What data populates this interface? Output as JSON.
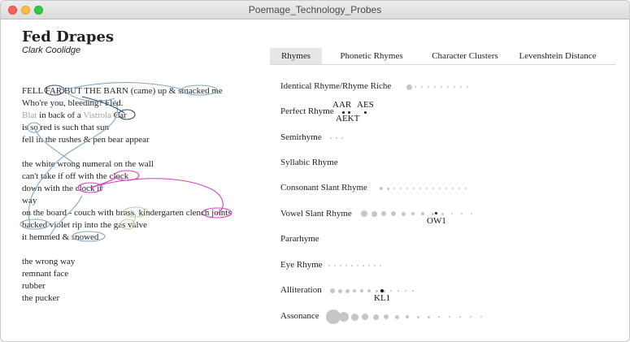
{
  "window": {
    "title": "Poemage_Technology_Probes"
  },
  "poem": {
    "title": "Fed Drapes",
    "author": "Clark Coolidge",
    "stanzas": [
      [
        "FELL FAR BUT THE BARN (came) up & smacked me",
        "Who're you, bleeding? Fled.",
        "Blat in back of a Vistrola Car",
        "is so red is such that sun",
        "fell in the rushes & pen bear appear"
      ],
      [
        "the white wrong numeral on the wall",
        "can't take if off with the clock",
        "down with the clock it",
        "way",
        "on the board - couch with brass, kindergarten clench joints",
        "backed violet rip into the gas valve",
        "it hemmed & snowed"
      ],
      [
        "the wrong way",
        "remnant face",
        "rubber",
        "the pucker"
      ]
    ]
  },
  "tabs": [
    {
      "label": "Rhymes",
      "active": true
    },
    {
      "label": "Phonetic Rhymes",
      "active": false
    },
    {
      "label": "Character Clusters",
      "active": false
    },
    {
      "label": "Levenshtein Distance",
      "active": false
    }
  ],
  "rhyme_types": [
    {
      "label": "Identical Rhyme/Rhyme Riche"
    },
    {
      "label": "Perfect Rhyme",
      "signatures": [
        "AAR",
        "AES",
        "AEKT"
      ]
    },
    {
      "label": "Semirhyme"
    },
    {
      "label": "Syllabic Rhyme"
    },
    {
      "label": "Consonant Slant Rhyme"
    },
    {
      "label": "Vowel Slant Rhyme",
      "signatures": [
        "OW1"
      ]
    },
    {
      "label": "Pararhyme"
    },
    {
      "label": "Eye Rhyme"
    },
    {
      "label": "Alliteration",
      "signatures": [
        "KL1"
      ]
    },
    {
      "label": "Assonance"
    }
  ],
  "colors": {
    "arc_blue": "#7fa6c4",
    "arc_dark_blue": "#2f4f6e",
    "arc_magenta": "#d53cc7",
    "arc_green": "#b7d39a",
    "dot_grey": "#c6c6c6",
    "dot_selected": "#111111",
    "tab_active_bg": "#e6e6e6"
  }
}
